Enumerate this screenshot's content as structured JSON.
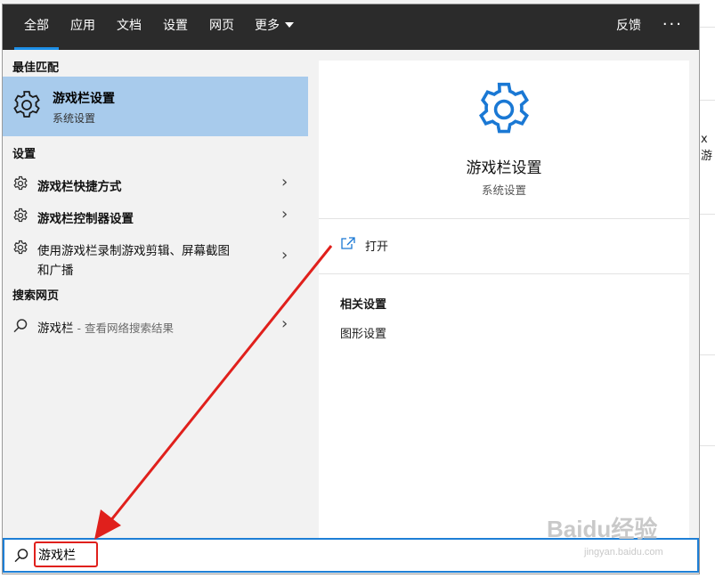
{
  "tabs": [
    {
      "label": "全部",
      "active": true
    },
    {
      "label": "应用"
    },
    {
      "label": "文档"
    },
    {
      "label": "设置"
    },
    {
      "label": "网页"
    },
    {
      "label": "更多"
    }
  ],
  "feedback_label": "反馈",
  "more_options_label": "···",
  "left": {
    "best_match_heading": "最佳匹配",
    "best_match": {
      "title": "游戏栏设置",
      "subtitle": "系统设置",
      "icon": "gear-icon"
    },
    "settings_heading": "设置",
    "settings_items": [
      {
        "label": "游戏栏快捷方式",
        "icon": "gear-icon"
      },
      {
        "label": "游戏栏控制器设置",
        "icon": "gear-icon"
      },
      {
        "label_line1": "使用游戏栏录制游戏剪辑、屏幕截图",
        "label_line2": "和广播",
        "icon": "gear-icon"
      }
    ],
    "web_heading": "搜索网页",
    "web_item": {
      "term": "游戏栏",
      "suffix": " - 查看网络搜索结果",
      "icon": "search-icon"
    }
  },
  "right": {
    "title": "游戏栏设置",
    "subtitle": "系统设置",
    "open_label": "打开",
    "related_heading": "相关设置",
    "related_items": [
      "图形设置"
    ]
  },
  "search": {
    "value": "游戏栏"
  },
  "background_fragment": "x游",
  "watermark": {
    "main": "Baidu经验",
    "sub": "jingyan.baidu.com"
  },
  "colors": {
    "accent": "#1e90e8",
    "highlight": "#a8cbec",
    "annotation": "#e0201c",
    "topbar": "#2b2b2b"
  }
}
